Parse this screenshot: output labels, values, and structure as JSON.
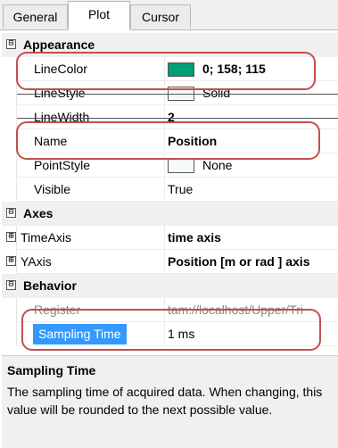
{
  "tabs": [
    {
      "label": "General",
      "active": false
    },
    {
      "label": "Plot",
      "active": true
    },
    {
      "label": "Cursor",
      "active": false
    }
  ],
  "categories": {
    "appearance": {
      "label": "Appearance",
      "expanded": true,
      "toggle": "⊟"
    },
    "axes": {
      "label": "Axes",
      "expanded": true,
      "toggle": "⊟"
    },
    "behavior": {
      "label": "Behavior",
      "expanded": true,
      "toggle": "⊟"
    }
  },
  "properties": {
    "line_color": {
      "name": "LineColor",
      "value": "0; 158; 115",
      "swatch": "#009e73"
    },
    "line_style": {
      "name": "LineStyle",
      "value": "Solid"
    },
    "line_width": {
      "name": "LineWidth",
      "value": "2"
    },
    "name": {
      "name": "Name",
      "value": "Position"
    },
    "point_style": {
      "name": "PointStyle",
      "value": "None"
    },
    "visible": {
      "name": "Visible",
      "value": "True"
    },
    "time_axis": {
      "name": "TimeAxis",
      "value": "time axis",
      "expander": "⊞"
    },
    "y_axis": {
      "name": "YAxis",
      "value": "Position [m or rad ] axis",
      "expander": "⊞"
    },
    "register": {
      "name": "Register",
      "value": "tam://localhost/Upper/Tri",
      "disabled": true
    },
    "sampling_time": {
      "name": "Sampling Time",
      "value": "1 ms",
      "selected": true
    }
  },
  "description": {
    "title": "Sampling Time",
    "text": "The sampling time of acquired data. When changing, this value will be rounded to the next possible value."
  },
  "colors": {
    "highlight_outline": "#c0504d",
    "selection": "#3399ff"
  }
}
